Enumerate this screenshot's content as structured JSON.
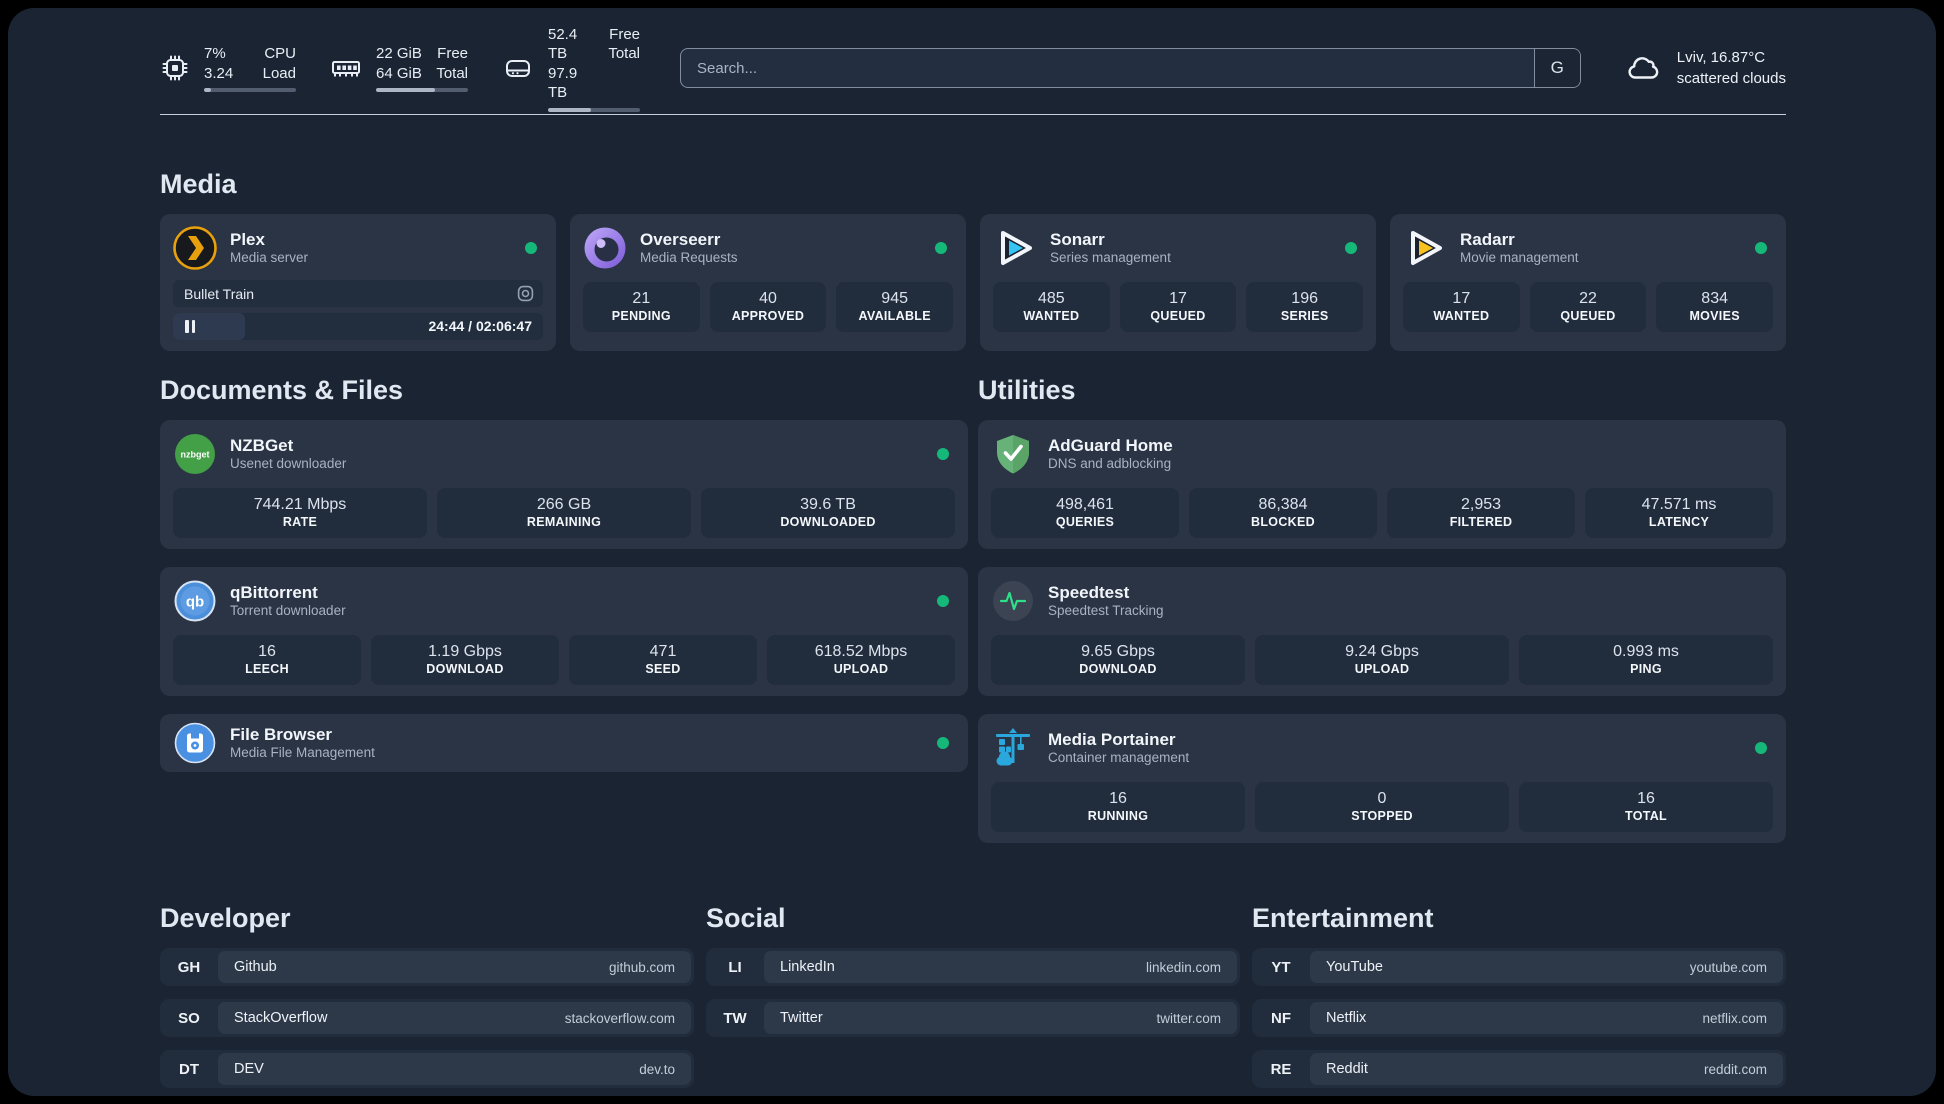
{
  "colors": {
    "page_bg": "#1a2433",
    "card_bg": "#2a3444",
    "tile_bg": "#212c3d",
    "status_online": "#16b87a",
    "plex_gold": "#e8a00d",
    "sonarr_blue": "#35c5f4",
    "radarr_gold": "#f7c21d",
    "adguard_green": "#67b279",
    "portainer_blue": "#2aa7dd"
  },
  "header": {
    "system": [
      {
        "icon": "cpu-icon",
        "value_top": "7%",
        "value_bottom": "3.24",
        "label_top": "CPU",
        "label_bottom": "Load",
        "progress_pct": 8
      },
      {
        "icon": "memory-icon",
        "value_top": "22 GiB",
        "value_bottom": "64 GiB",
        "label_top": "Free",
        "label_bottom": "Total",
        "progress_pct": 64
      },
      {
        "icon": "disk-icon",
        "value_top": "52.4 TB",
        "value_bottom": "97.9 TB",
        "label_top": "Free",
        "label_bottom": "Total",
        "progress_pct": 47
      }
    ],
    "search": {
      "placeholder": "Search...",
      "engine_button": "G"
    },
    "weather": {
      "icon": "cloud-icon",
      "line1": "Lviv, 16.87°C",
      "line2": "scattered clouds"
    }
  },
  "media": {
    "title": "Media",
    "plex": {
      "name": "Plex",
      "desc": "Media server",
      "status": "online",
      "player": {
        "title": "Bullet Train",
        "time": "24:44 / 02:06:47",
        "progress_pct": 19.5
      }
    },
    "apps": [
      {
        "name": "Overseerr",
        "desc": "Media Requests",
        "status": "online",
        "stats": [
          {
            "value": "21",
            "label": "PENDING"
          },
          {
            "value": "40",
            "label": "APPROVED"
          },
          {
            "value": "945",
            "label": "AVAILABLE"
          }
        ]
      },
      {
        "name": "Sonarr",
        "desc": "Series management",
        "status": "online",
        "stats": [
          {
            "value": "485",
            "label": "WANTED"
          },
          {
            "value": "17",
            "label": "QUEUED"
          },
          {
            "value": "196",
            "label": "SERIES"
          }
        ]
      },
      {
        "name": "Radarr",
        "desc": "Movie management",
        "status": "online",
        "stats": [
          {
            "value": "17",
            "label": "WANTED"
          },
          {
            "value": "22",
            "label": "QUEUED"
          },
          {
            "value": "834",
            "label": "MOVIES"
          }
        ]
      }
    ]
  },
  "documents": {
    "title": "Documents & Files",
    "apps": [
      {
        "name": "NZBGet",
        "desc": "Usenet downloader",
        "status": "online",
        "stats": [
          {
            "value": "744.21 Mbps",
            "label": "RATE"
          },
          {
            "value": "266 GB",
            "label": "REMAINING"
          },
          {
            "value": "39.6 TB",
            "label": "DOWNLOADED"
          }
        ]
      },
      {
        "name": "qBittorrent",
        "desc": "Torrent downloader",
        "status": "online",
        "stats": [
          {
            "value": "16",
            "label": "LEECH"
          },
          {
            "value": "1.19 Gbps",
            "label": "DOWNLOAD"
          },
          {
            "value": "471",
            "label": "SEED"
          },
          {
            "value": "618.52 Mbps",
            "label": "UPLOAD"
          }
        ]
      },
      {
        "name": "File Browser",
        "desc": "Media File Management",
        "status": "online"
      }
    ]
  },
  "utilities": {
    "title": "Utilities",
    "apps": [
      {
        "name": "AdGuard Home",
        "desc": "DNS and adblocking",
        "stats": [
          {
            "value": "498,461",
            "label": "QUERIES"
          },
          {
            "value": "86,384",
            "label": "BLOCKED"
          },
          {
            "value": "2,953",
            "label": "FILTERED"
          },
          {
            "value": "47.571 ms",
            "label": "LATENCY"
          }
        ]
      },
      {
        "name": "Speedtest",
        "desc": "Speedtest Tracking",
        "stats": [
          {
            "value": "9.65 Gbps",
            "label": "DOWNLOAD"
          },
          {
            "value": "9.24 Gbps",
            "label": "UPLOAD"
          },
          {
            "value": "0.993 ms",
            "label": "PING"
          }
        ]
      },
      {
        "name": "Media Portainer",
        "desc": "Container management",
        "status": "online",
        "stats": [
          {
            "value": "16",
            "label": "RUNNING"
          },
          {
            "value": "0",
            "label": "STOPPED"
          },
          {
            "value": "16",
            "label": "TOTAL"
          }
        ]
      }
    ]
  },
  "bookmarks": [
    {
      "title": "Developer",
      "items": [
        {
          "abbr": "GH",
          "name": "Github",
          "url": "github.com"
        },
        {
          "abbr": "SO",
          "name": "StackOverflow",
          "url": "stackoverflow.com"
        },
        {
          "abbr": "DT",
          "name": "DEV",
          "url": "dev.to"
        }
      ]
    },
    {
      "title": "Social",
      "items": [
        {
          "abbr": "LI",
          "name": "LinkedIn",
          "url": "linkedin.com"
        },
        {
          "abbr": "TW",
          "name": "Twitter",
          "url": "twitter.com"
        }
      ]
    },
    {
      "title": "Entertainment",
      "items": [
        {
          "abbr": "YT",
          "name": "YouTube",
          "url": "youtube.com"
        },
        {
          "abbr": "NF",
          "name": "Netflix",
          "url": "netflix.com"
        },
        {
          "abbr": "RE",
          "name": "Reddit",
          "url": "reddit.com"
        }
      ]
    }
  ]
}
